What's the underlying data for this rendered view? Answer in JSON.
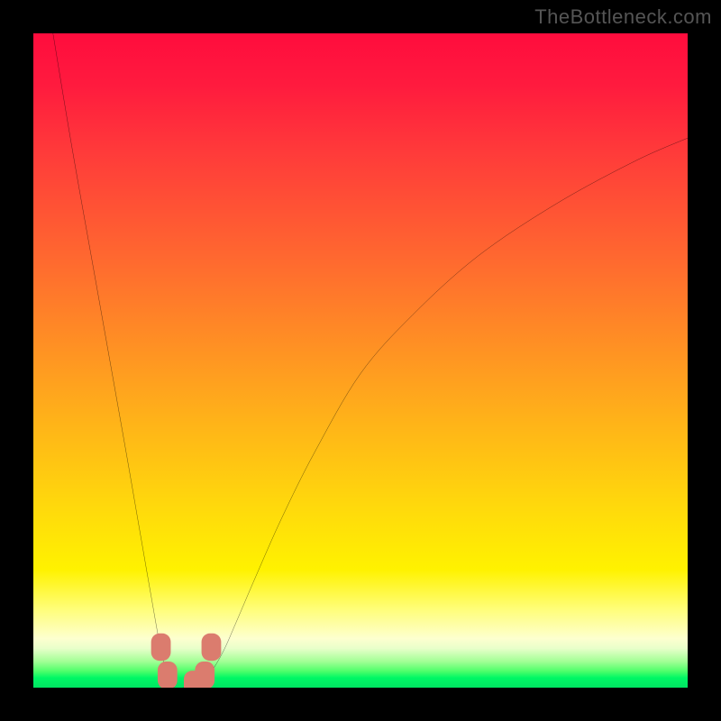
{
  "watermark": "TheBottleneck.com",
  "chart_data": {
    "type": "line",
    "title": "",
    "xlabel": "",
    "ylabel": "",
    "xlim": [
      0,
      100
    ],
    "ylim": [
      0,
      100
    ],
    "grid": false,
    "legend": false,
    "series": [
      {
        "name": "curve",
        "x": [
          3,
          6,
          10,
          14,
          16,
          18,
          19.5,
          20.5,
          21.5,
          23,
          25,
          27,
          29,
          31,
          34,
          38,
          43,
          50,
          58,
          68,
          80,
          92,
          100
        ],
        "y": [
          100,
          82,
          59.5,
          37,
          25.5,
          14,
          5.7,
          2,
          0,
          0,
          0.3,
          2.2,
          5.5,
          10,
          17,
          26,
          36,
          48,
          57,
          66,
          74,
          80.5,
          84
        ]
      }
    ],
    "markers": [
      {
        "x": 19.5,
        "y": 6.2
      },
      {
        "x": 20.5,
        "y": 1.9
      },
      {
        "x": 24.5,
        "y": 0.5
      },
      {
        "x": 26.2,
        "y": 1.9
      },
      {
        "x": 27.2,
        "y": 6.2
      }
    ],
    "marker_style": {
      "shape": "rounded-rect",
      "fill": "#db7c6e",
      "w": 3.0,
      "h": 4.2,
      "rx": 1.3
    }
  }
}
